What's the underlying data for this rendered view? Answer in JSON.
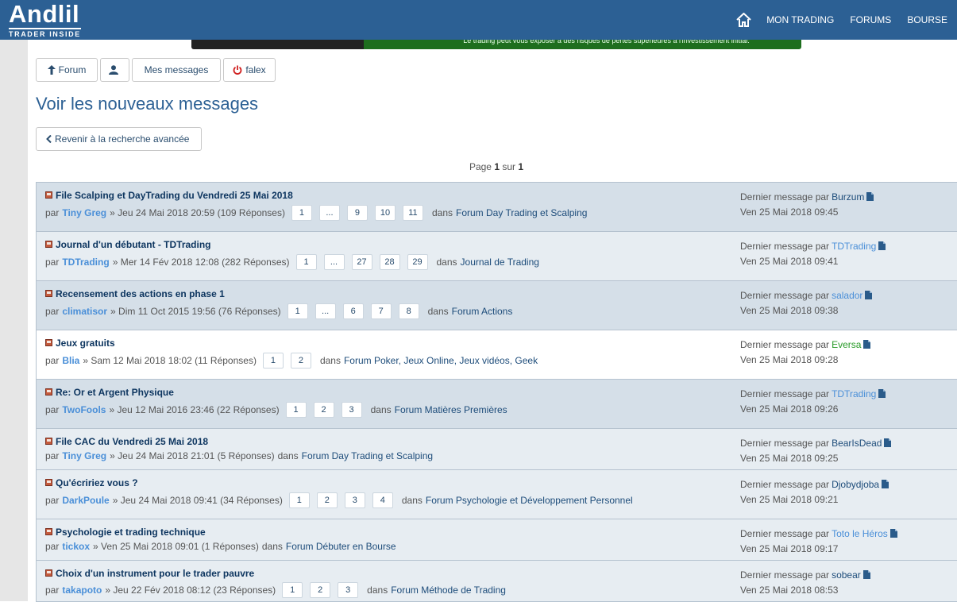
{
  "header": {
    "logo_name": "Andlil",
    "logo_tagline": "TRADER INSIDE",
    "nav": [
      "MON TRADING",
      "FORUMS",
      "BOURSE"
    ],
    "banner_text": "Le trading peut vous exposer à des risques de pertes supérieures à l'investissement initial."
  },
  "toolbar": {
    "forum_label": "Forum",
    "messages_label": "Mes messages",
    "user_label": "falex"
  },
  "page": {
    "title": "Voir les nouveaux messages",
    "back_label": "Revenir à la recherche avancée",
    "pagination": {
      "prefix": "Page",
      "current": "1",
      "sep": "sur",
      "total": "1"
    }
  },
  "labels": {
    "by": "par",
    "in": "dans",
    "last_by": "Dernier message par"
  },
  "colors": {
    "header_bg": "#2c6094",
    "title": "#2c6094",
    "link_blue": "#4a8fd8",
    "link_dark": "#1d4c7a",
    "green_user": "#2a9b2a"
  },
  "topics": [
    {
      "title": "File Scalping et DayTrading du Vendredi 25 Mai 2018",
      "author": "Tiny Greg",
      "date": "» Jeu 24 Mai 2018 20:59 (109 Réponses)",
      "pages": [
        "1",
        "...",
        "9",
        "10",
        "11"
      ],
      "forum": "Forum Day Trading et Scalping",
      "last_author": "Burzum",
      "last_color": "#1d4c7a",
      "last_date": "Ven 25 Mai 2018 09:45"
    },
    {
      "title": "Journal d'un débutant - TDTrading",
      "author": "TDTrading",
      "date": "» Mer 14 Fév 2018 12:08 (282 Réponses)",
      "pages": [
        "1",
        "...",
        "27",
        "28",
        "29"
      ],
      "forum": "Journal de Trading",
      "last_author": "TDTrading",
      "last_color": "#4a8fd8",
      "last_date": "Ven 25 Mai 2018 09:41"
    },
    {
      "title": "Recensement des actions en phase 1",
      "author": "climatisor",
      "date": "» Dim 11 Oct 2015 19:56 (76 Réponses)",
      "pages": [
        "1",
        "...",
        "6",
        "7",
        "8"
      ],
      "forum": "Forum Actions",
      "last_author": "salador",
      "last_color": "#4a8fd8",
      "last_date": "Ven 25 Mai 2018 09:38"
    },
    {
      "title": "Jeux gratuits",
      "author": "Blia",
      "date": "» Sam 12 Mai 2018 18:02 (11 Réponses)",
      "pages": [
        "1",
        "2"
      ],
      "forum": "Forum Poker, Jeux Online, Jeux vidéos, Geek",
      "last_author": "Eversa",
      "last_color": "#2a9b2a",
      "last_date": "Ven 25 Mai 2018 09:28"
    },
    {
      "title": "Re: Or et Argent Physique",
      "author": "TwoFools",
      "date": "» Jeu 12 Mai 2016 23:46 (22 Réponses)",
      "pages": [
        "1",
        "2",
        "3"
      ],
      "forum": "Forum Matières Premières",
      "last_author": "TDTrading",
      "last_color": "#4a8fd8",
      "last_date": "Ven 25 Mai 2018 09:26"
    },
    {
      "title": "File CAC du Vendredi 25 Mai 2018",
      "author": "Tiny Greg",
      "date": "» Jeu 24 Mai 2018 21:01 (5 Réponses)",
      "pages": [],
      "forum": "Forum Day Trading et Scalping",
      "last_author": "BearIsDead",
      "last_color": "#1d4c7a",
      "last_date": "Ven 25 Mai 2018 09:25"
    },
    {
      "title": "Qu'écririez vous ?",
      "author": "DarkPoule",
      "date": "» Jeu 24 Mai 2018 09:41 (34 Réponses)",
      "pages": [
        "1",
        "2",
        "3",
        "4"
      ],
      "forum": "Forum Psychologie et Développement Personnel",
      "last_author": "Djobydjoba",
      "last_color": "#1d4c7a",
      "last_date": "Ven 25 Mai 2018 09:21"
    },
    {
      "title": "Psychologie et trading technique",
      "author": "tickox",
      "date": "» Ven 25 Mai 2018 09:01 (1 Réponses)",
      "pages": [],
      "forum": "Forum Débuter en Bourse",
      "last_author": "Toto le Héros",
      "last_color": "#4a8fd8",
      "last_date": "Ven 25 Mai 2018 09:17"
    },
    {
      "title": "Choix d'un instrument pour le trader pauvre",
      "author": "takapoto",
      "date": "» Jeu 22 Fév 2018 08:12 (23 Réponses)",
      "pages": [
        "1",
        "2",
        "3"
      ],
      "forum": "Forum Méthode de Trading",
      "last_author": "sobear",
      "last_color": "#1d4c7a",
      "last_date": "Ven 25 Mai 2018 08:53"
    }
  ]
}
